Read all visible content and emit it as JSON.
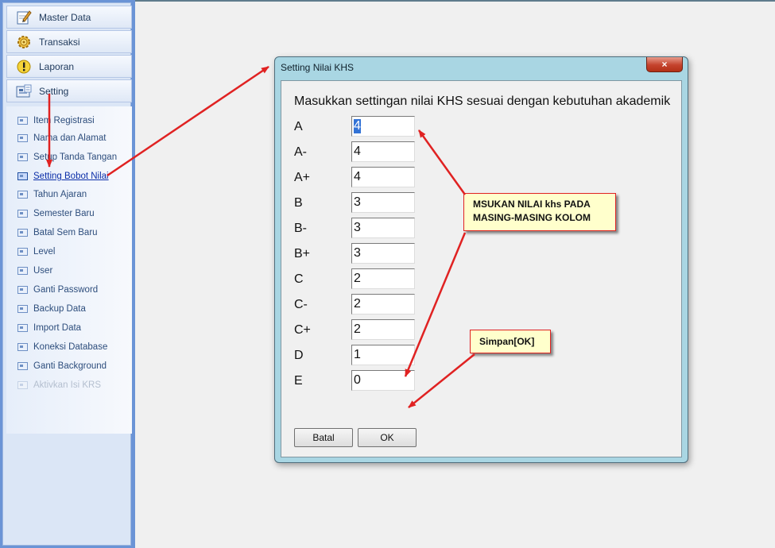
{
  "nav": {
    "groups": [
      {
        "label": "Master Data",
        "icon": "pencil-note-icon"
      },
      {
        "label": "Transaksi",
        "icon": "gear-icon"
      },
      {
        "label": "Laporan",
        "icon": "warning-icon"
      },
      {
        "label": "Setting",
        "icon": "settings-folder-icon"
      }
    ],
    "items": [
      "Item Registrasi",
      "Nama dan Alamat",
      "Setup Tanda Tangan",
      "Setting Bobot Nilai",
      "Tahun Ajaran",
      "Semester Baru",
      "Batal Sem Baru",
      "Level",
      "User",
      "Ganti Password",
      "Backup Data",
      "Import Data",
      "Koneksi Database",
      "Ganti Background",
      "Aktivkan Isi KRS"
    ],
    "selected_item": "Setting Bobot Nilai",
    "disabled_item": "Aktivkan Isi KRS"
  },
  "dialog": {
    "title": "Setting Nilai KHS",
    "close_glyph": "×",
    "instruction": "Masukkan settingan nilai KHS sesuai dengan kebutuhan akademik",
    "grades": [
      {
        "label": "A",
        "value": "4"
      },
      {
        "label": "A-",
        "value": "4"
      },
      {
        "label": "A+",
        "value": "4"
      },
      {
        "label": "B",
        "value": "3"
      },
      {
        "label": "B-",
        "value": "3"
      },
      {
        "label": "B+",
        "value": "3"
      },
      {
        "label": "C",
        "value": "2"
      },
      {
        "label": "C-",
        "value": "2"
      },
      {
        "label": "C+",
        "value": "2"
      },
      {
        "label": "D",
        "value": "1"
      },
      {
        "label": "E",
        "value": "0"
      }
    ],
    "cancel_label": "Batal",
    "ok_label": "OK"
  },
  "callouts": {
    "fill_columns": {
      "line1": "MSUKAN NILAI khs PADA",
      "line2": "MASING-MASING KOLOM"
    },
    "save": "Simpan[OK]"
  },
  "colors": {
    "nav_frame": "#6b94d6",
    "dialog_frame": "#a9d6e3",
    "close_button": "#c4432d",
    "callout_fill": "#ffffcc",
    "arrow": "#e02222"
  }
}
